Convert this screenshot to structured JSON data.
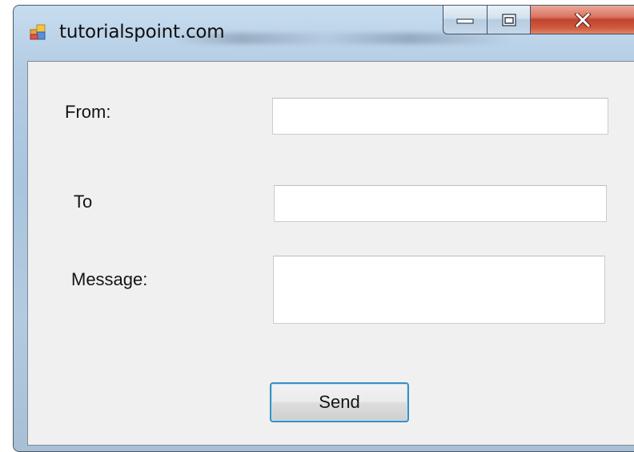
{
  "window": {
    "title": "tutorialspoint.com",
    "icon": "app-form-icon",
    "controls": {
      "minimize_icon": "minimize-icon",
      "maximize_icon": "maximize-icon",
      "close_icon": "close-icon"
    },
    "colors": {
      "close_button": "#c84a33",
      "client_background": "#f0f0f0",
      "button_focus_border": "#3c8fc1"
    }
  },
  "form": {
    "from": {
      "label": "From:",
      "value": ""
    },
    "to": {
      "label": "To",
      "value": ""
    },
    "message": {
      "label": "Message:",
      "value": ""
    },
    "send_label": "Send"
  }
}
